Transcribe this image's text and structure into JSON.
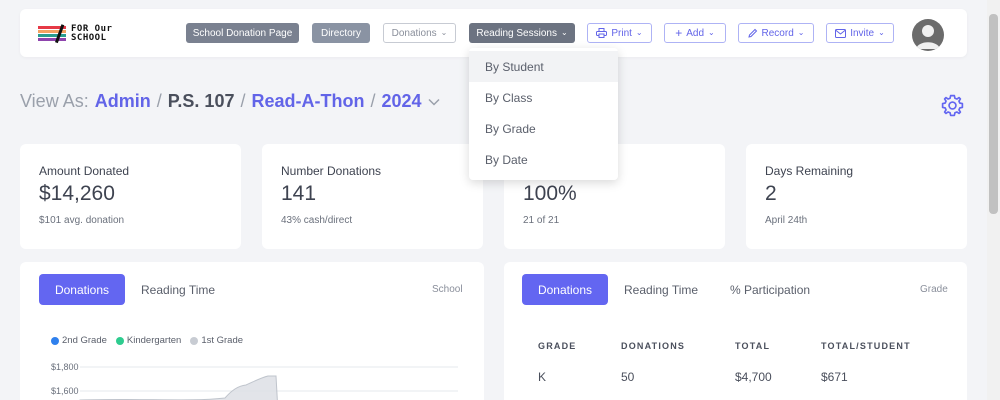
{
  "nav": {
    "logo_text_1": "FOR Our",
    "logo_text_2": "SCHOOL",
    "school_donation_page": "School Donation Page",
    "directory": "Directory",
    "donations": "Donations",
    "reading_sessions": "Reading Sessions",
    "print": "Print",
    "add": "Add",
    "record": "Record",
    "invite": "Invite"
  },
  "dropdown": {
    "items": [
      "By Student",
      "By Class",
      "By Grade",
      "By Date"
    ]
  },
  "view_as": {
    "label": "View As:",
    "role": "Admin",
    "school": "P.S. 107",
    "event": "Read-A-Thon",
    "year": "2024"
  },
  "stats": [
    {
      "label": "Amount Donated",
      "value": "$14,260",
      "sub": "$101 avg. donation"
    },
    {
      "label": "Number Donations",
      "value": "141",
      "sub": "43% cash/direct"
    },
    {
      "label": "",
      "value": "100%",
      "sub": "21 of 21"
    },
    {
      "label": "Days Remaining",
      "value": "2",
      "sub": "April 24th"
    }
  ],
  "left_panel": {
    "tab_active": "Donations",
    "tab_2": "Reading Time",
    "corner": "School"
  },
  "right_panel": {
    "tab_active": "Donations",
    "tab_2": "Reading Time",
    "tab_3": "% Participation",
    "corner": "Grade",
    "table": {
      "headers": [
        "GRADE",
        "DONATIONS",
        "TOTAL",
        "TOTAL/STUDENT"
      ],
      "rows": [
        [
          "K",
          "50",
          "$4,700",
          "$671"
        ]
      ]
    }
  },
  "colors": {
    "accent": "#6366f1",
    "series_2nd_grade": "#2f80ed",
    "series_kindergarten": "#2ecc8f",
    "series_1st_grade": "#c8ccd3"
  },
  "chart_data": {
    "type": "area",
    "series": [
      {
        "name": "2nd Grade",
        "color": "#2f80ed"
      },
      {
        "name": "Kindergarten",
        "color": "#2ecc8f"
      },
      {
        "name": "1st Grade",
        "color": "#c8ccd3"
      }
    ],
    "y_tick_labels": [
      "$1,800",
      "$1,600"
    ]
  }
}
